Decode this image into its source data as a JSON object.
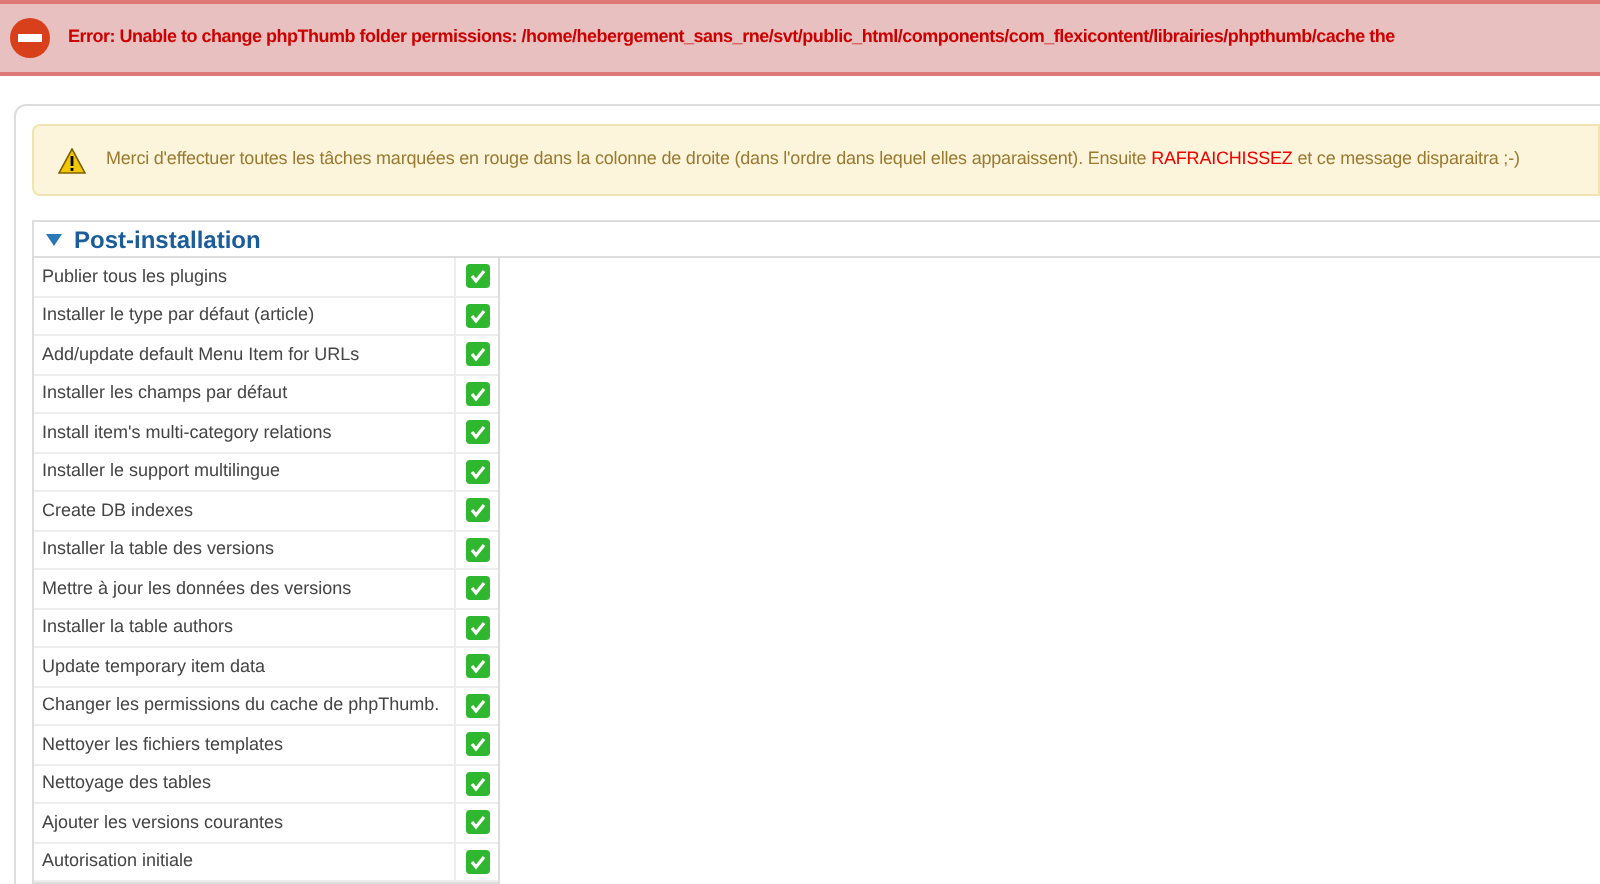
{
  "error_bar": {
    "message": "Error: Unable to change phpThumb folder permissions: /home/hebergement_sans_rne/svt/public_html/components/com_flexicontent/librairies/phpthumb/cache the"
  },
  "notice": {
    "text_before": "Merci d'effectuer toutes les tâches marquées en rouge dans la colonne de droite (dans l'ordre dans lequel elles apparaissent). Ensuite ",
    "highlight": "RAFRAICHISSEZ",
    "text_after": " et ce message disparaitra ;-)"
  },
  "section": {
    "title": "Post-installation",
    "expanded": true
  },
  "tasks": [
    {
      "label": "Publier tous les plugins",
      "done": true
    },
    {
      "label": "Installer le type par défaut (article)",
      "done": true
    },
    {
      "label": "Add/update default Menu Item for URLs",
      "done": true
    },
    {
      "label": "Installer les champs par défaut",
      "done": true
    },
    {
      "label": "Install item's multi-category relations",
      "done": true
    },
    {
      "label": "Installer le support multilingue",
      "done": true
    },
    {
      "label": "Create DB indexes",
      "done": true
    },
    {
      "label": "Installer la table des versions",
      "done": true
    },
    {
      "label": "Mettre à jour les données des versions",
      "done": true
    },
    {
      "label": "Installer la table authors",
      "done": true
    },
    {
      "label": "Update temporary item data",
      "done": true
    },
    {
      "label": "Changer les permissions du cache de phpThumb.",
      "done": true
    },
    {
      "label": "Nettoyer les fichiers templates",
      "done": true
    },
    {
      "label": "Nettoyage des tables",
      "done": true
    },
    {
      "label": "Ajouter les versions courantes",
      "done": true
    },
    {
      "label": "Autorisation initiale",
      "done": true
    }
  ]
}
